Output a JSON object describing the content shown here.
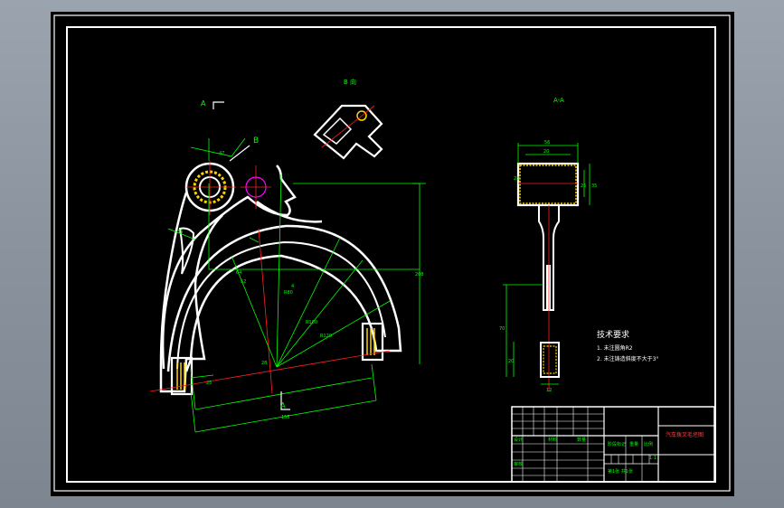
{
  "sheet": {
    "background": "#000000",
    "line_color": "#ffffff",
    "dim_color": "#00ff00",
    "center_color": "#ff2020",
    "hidden_color": "#ff00ff",
    "section_color": "#ffff00"
  },
  "views": {
    "main_label_a1": "A",
    "main_label_a2": "A",
    "main_label_b": "B",
    "aux_view_label": "B 向",
    "section_view_label": "A-A"
  },
  "dimensions": {
    "main": [
      "47",
      "35",
      "52",
      "R80",
      "R100",
      "R120",
      "155",
      "208",
      "28",
      "25",
      "64",
      "4"
    ],
    "section": [
      "56",
      "20",
      "35",
      "25",
      "23",
      "70",
      "20",
      "12"
    ]
  },
  "tech_requirements": {
    "title": "技术要求",
    "items": [
      "1. 未注圆角R2",
      "2. 未注铸造斜度不大于3°"
    ]
  },
  "title_block": {
    "drawing_title": "汽车拨叉毛坯图",
    "scale_label": "比例",
    "scale_value": "1:1",
    "material_label": "材料",
    "qty_label": "数量",
    "design_label": "设计",
    "check_label": "审核",
    "sheet_label": "第1张 共1张",
    "zone_label": "阶段标记",
    "weight_label": "重量"
  }
}
